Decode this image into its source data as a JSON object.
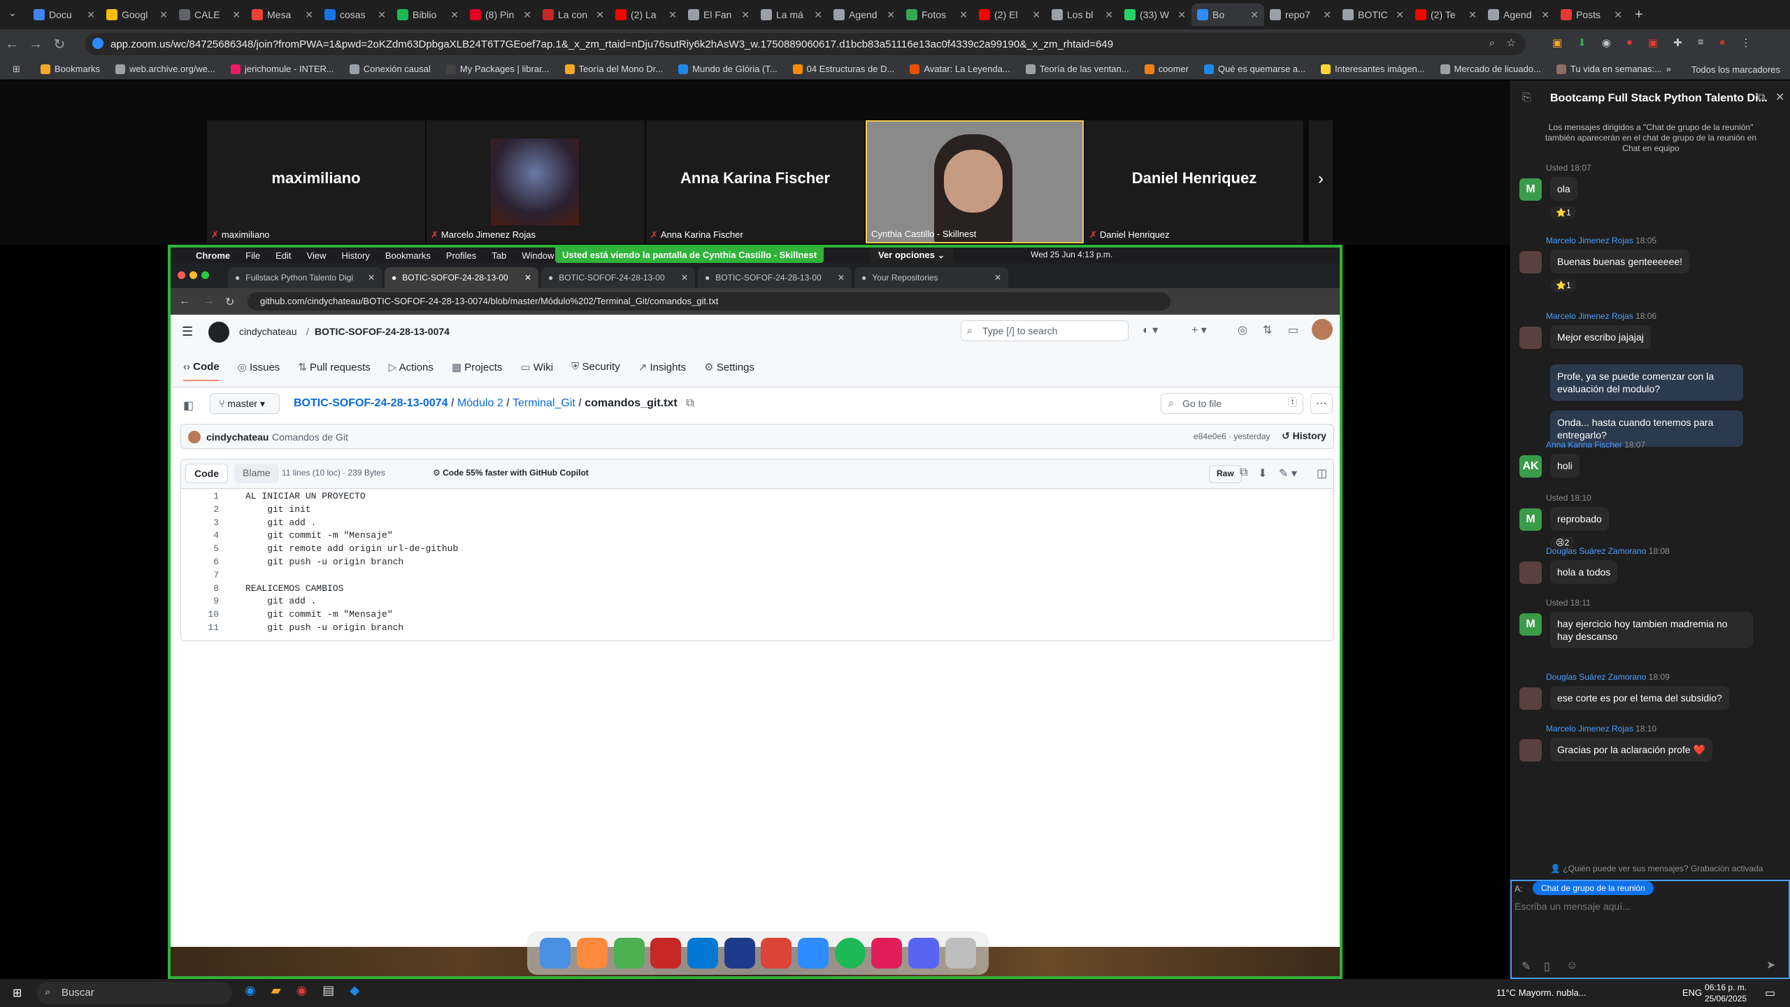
{
  "browser": {
    "tabs": [
      {
        "title": "Docu",
        "color": "#4285f4"
      },
      {
        "title": "Googl",
        "color": "#fbbc04"
      },
      {
        "title": "CALE",
        "color": "#5f6368"
      },
      {
        "title": "Mesa",
        "color": "#ea4335"
      },
      {
        "title": "cosas",
        "color": "#1a73e8"
      },
      {
        "title": "Biblio",
        "color": "#1db954"
      },
      {
        "title": "(8) Pin",
        "color": "#e60023"
      },
      {
        "title": "La con",
        "color": "#c62828"
      },
      {
        "title": "(2) La",
        "color": "#ff0000"
      },
      {
        "title": "El Fan",
        "color": "#9aa0a6"
      },
      {
        "title": "La má",
        "color": "#9aa0a6"
      },
      {
        "title": "Agend",
        "color": "#9aa0a6"
      },
      {
        "title": "Fotos",
        "color": "#34a853"
      },
      {
        "title": "(2) El",
        "color": "#ff0000"
      },
      {
        "title": "Los bl",
        "color": "#9aa0a6"
      },
      {
        "title": "(33) W",
        "color": "#25d366"
      },
      {
        "title": "Bo",
        "color": "#2d8cff"
      },
      {
        "title": "repo7",
        "color": "#9aa0a6"
      },
      {
        "title": "BOTIC",
        "color": "#9aa0a6"
      },
      {
        "title": "(2) Te",
        "color": "#ff0000"
      },
      {
        "title": "Agend",
        "color": "#9aa0a6"
      },
      {
        "title": "Posts",
        "color": "#e53935"
      }
    ],
    "url": "app.zoom.us/wc/84725686348/join?fromPWA=1&pwd=2oKZdm63DpbgaXLB24T6T7GEoef7ap.1&_x_zm_rtaid=nDju76sutRiy6k2hAsW3_w.1750889060617.d1bcb83a51116e13ac0f4339c2a99190&_x_zm_rhtaid=649",
    "bookmarks": [
      "Bookmarks",
      "web.archive.org/we...",
      "jerichomule - INTER...",
      "Conexión causal",
      "My Packages | librar...",
      "Teoría del Mono Dr...",
      "Mundo de Glória (T...",
      "04 Estructuras de D...",
      "Avatar: La Leyenda...",
      "Teoría de las ventan...",
      "coomer",
      "Qué es quemarse a...",
      "Interesantes imágen...",
      "Mercado de licuado...",
      "Tu vida en semanas:..."
    ],
    "all_bookmarks": "Todos los marcadores"
  },
  "zoom": {
    "participants": [
      {
        "name": "maximiliano",
        "label": "maximiliano"
      },
      {
        "name": "",
        "label": "Marcelo Jimenez Rojas"
      },
      {
        "name": "Anna Karina Fischer",
        "label": "Anna Karina Fischer"
      },
      {
        "name": "",
        "label": "Cynthia Castillo - Skillnest"
      },
      {
        "name": "Daniel Henriquez",
        "label": "Daniel Henriquez"
      }
    ],
    "share_banner": "Usted está viendo la pantalla de  Cynthia Castillo - Skillnest",
    "view_options": "Ver opciones"
  },
  "mac": {
    "menu": [
      "Chrome",
      "File",
      "Edit",
      "View",
      "History",
      "Bookmarks",
      "Profiles",
      "Tab",
      "Window"
    ],
    "clock": "Wed 25 Jun  4:13 p.m.",
    "tabs": [
      "Fullstack Python Talento Digi",
      "BOTIC-SOFOF-24-28-13-00",
      "BOTIC-SOFOF-24-28-13-00",
      "BOTIC-SOFOF-24-28-13-00",
      "Your Repositories"
    ],
    "url": "github.com/cindychateau/BOTIC-SOFOF-24-28-13-0074/blob/master/Módulo%202/Terminal_Git/comandos_git.txt"
  },
  "github": {
    "owner": "cindychateau",
    "repo": "BOTIC-SOFOF-24-28-13-0074",
    "search": "Type [/] to search",
    "tabs": [
      "Code",
      "Issues",
      "Pull requests",
      "Actions",
      "Projects",
      "Wiki",
      "Security",
      "Insights",
      "Settings"
    ],
    "branch": "master",
    "path": [
      "BOTIC-SOFOF-24-28-13-0074",
      "Módulo 2",
      "Terminal_Git",
      "comandos_git.txt"
    ],
    "go_to_file": "Go to file",
    "commit_author": "cindychateau",
    "commit_msg": "Comandos de Git",
    "commit_meta": "e84e0e6 · yesterday",
    "history": "History",
    "code_tab": "Code",
    "blame_tab": "Blame",
    "file_info": "11 lines (10 loc) · 239 Bytes",
    "copilot": "Code 55% faster with GitHub Copilot",
    "raw": "Raw",
    "lines": [
      "AL INICIAR UN PROYECTO",
      "    git init",
      "    git add .",
      "    git commit -m \"Mensaje\"",
      "    git remote add origin url-de-github",
      "    git push -u origin branch",
      "",
      "REALICEMOS CAMBIOS",
      "    git add .",
      "    git commit -m \"Mensaje\"",
      "    git push -u origin branch"
    ]
  },
  "chat": {
    "title": "Bootcamp Full Stack Python Talento Di...",
    "info": "Los mensajes dirigidos a \"Chat de grupo de la reunión\" también aparecerán en el chat de grupo de la reunión en Chat en equipo",
    "items": [
      {
        "meta_you": "Usted 18:07",
        "text": "ola",
        "av": "M",
        "avcolor": "#3a9b4a",
        "react": "⭐1"
      },
      {
        "name": "Marcelo Jimenez Rojas",
        "time": "18:05",
        "text": "Buenas buenas genteeeeee!",
        "react": "⭐1"
      },
      {
        "name": "Marcelo Jimenez Rojas",
        "time": "18:06",
        "text": "Mejor escribo jajajaj"
      },
      {
        "text": "Profe, ya se puede comenzar con la evaluación del modulo?"
      },
      {
        "text": "Onda... hasta cuando tenemos para entregarlo?"
      },
      {
        "name": "Anna Karina Fischer",
        "time": "18:07",
        "text": "holi",
        "av": "AK",
        "avcolor": "#3a9b4a"
      },
      {
        "meta_you": "Usted 18:10",
        "text": "reprobado",
        "av": "M",
        "avcolor": "#3a9b4a",
        "react": "😢2"
      },
      {
        "name": "Douglas Suárez Zamorano",
        "time": "18:08",
        "text": "hola a todos"
      },
      {
        "meta_you": "Usted 18:11",
        "text": "hay ejercicio hoy tambien madremia no hay descanso",
        "av": "M",
        "avcolor": "#3a9b4a"
      },
      {
        "name": "Douglas Suárez Zamorano",
        "time": "18:09",
        "text": "ese corte es por el tema del subsidio?"
      },
      {
        "name": "Marcelo Jimenez Rojas",
        "time": "18:10",
        "text": "Gracias por la aclaración profe ❤️"
      }
    ],
    "who_sees": "¿Quién puede ver sus mensajes? Grabación activada",
    "to_label": "A:",
    "to_target": "Chat de grupo de la reunión",
    "placeholder": "Escriba un mensaje aquí..."
  },
  "taskbar": {
    "search": "Buscar",
    "weather": "11°C  Mayorm. nubla...",
    "lang": "ENG",
    "time": "06:16 p. m.",
    "date": "25/06/2025"
  }
}
